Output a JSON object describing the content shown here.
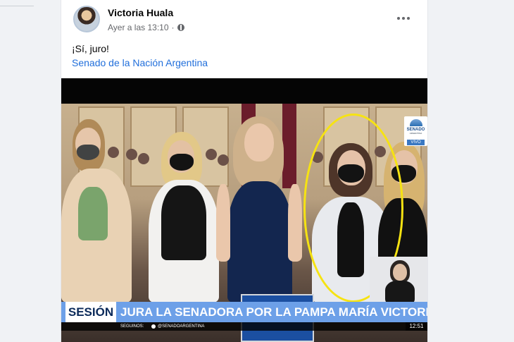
{
  "post": {
    "author": "Victoria Huala",
    "timestamp": "Ayer a las 13:10",
    "separator": "·",
    "text": "¡Sí, juro!",
    "link": "Senado de la Nación Argentina"
  },
  "video": {
    "section_label": "SESIÓN",
    "headline": "JURA LA SENADORA POR LA PAMPA MARÍA VICTORIA HUALA",
    "bottom_label": "SEGUINOS:",
    "handle": "@SENADOARGENTINA",
    "time": "12:51",
    "badge_title": "SENADO",
    "badge_sub": "ARGENTINA",
    "live_label": "VIVO"
  },
  "colors": {
    "highlight": "#f6e312",
    "link": "#216fdb",
    "lower_third": "#6da0e8"
  },
  "icons": [
    "globe-icon",
    "more-options-icon",
    "senado-seal-icon",
    "dot-icon"
  ]
}
